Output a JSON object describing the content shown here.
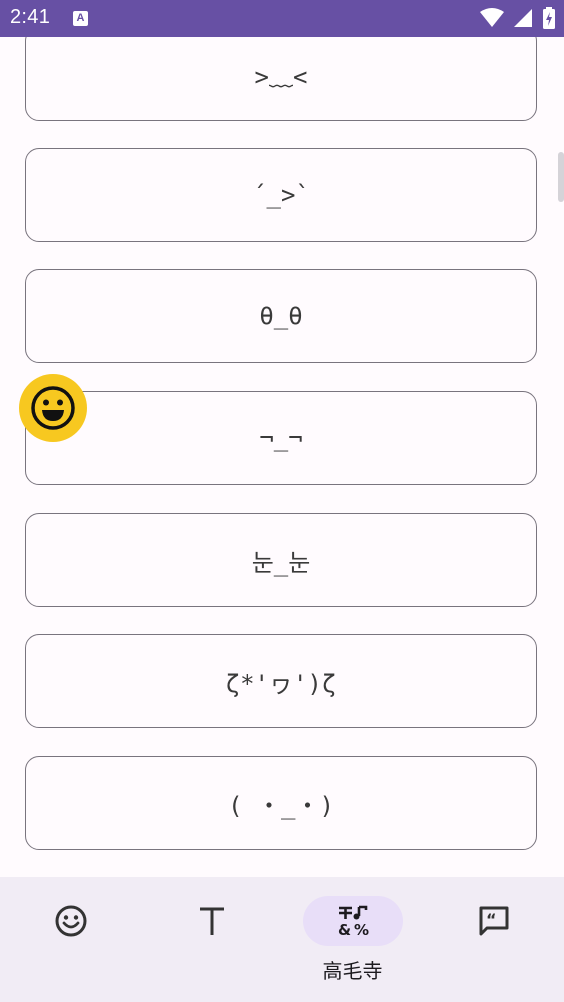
{
  "status_bar": {
    "time": "2:41",
    "notification_glyph": "A",
    "icons": [
      "wifi-icon",
      "signal-icon",
      "battery-icon"
    ]
  },
  "kaomoji_list": [
    {
      "text": ">﹏<"
    },
    {
      "text": "´_>`"
    },
    {
      "text": "θ_θ"
    },
    {
      "text": "¬_¬"
    },
    {
      "text": "눈_눈"
    },
    {
      "text": "ζ*'ヮ')ζ"
    },
    {
      "text": "( ・_・)"
    }
  ],
  "floating_button": {
    "icon": "smiley-face-icon",
    "color": "#f7c820"
  },
  "bottom_nav": {
    "items": [
      {
        "icon": "smiley-icon",
        "label": "",
        "active": false
      },
      {
        "icon": "text-format-icon",
        "label": "",
        "active": false
      },
      {
        "icon": "symbols-icon",
        "label": "高毛寺",
        "active": true
      },
      {
        "icon": "quote-bubble-icon",
        "label": "",
        "active": false
      }
    ]
  },
  "colors": {
    "accent": "#6750a4",
    "nav_background": "#f1ecf5",
    "active_pill": "#e8def8",
    "card_border": "#79747e"
  }
}
